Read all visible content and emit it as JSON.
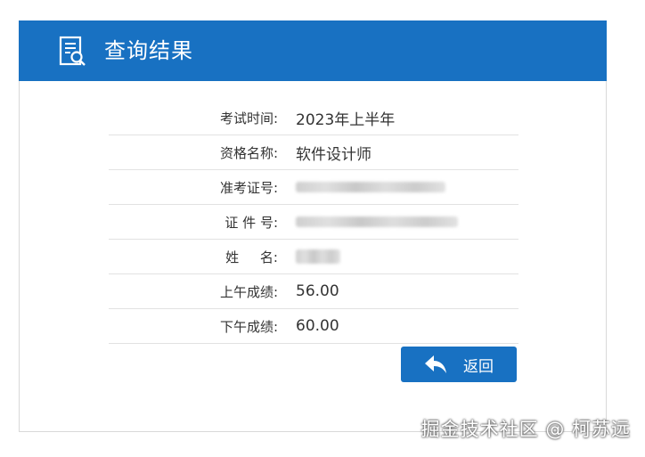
{
  "header": {
    "title": "查询结果",
    "icon": "document-search-icon"
  },
  "rows": [
    {
      "label": "考试时间:",
      "value": "2023年上半年"
    },
    {
      "label": "资格名称:",
      "value": "软件设计师"
    },
    {
      "label": "准考证号:",
      "value": ""
    },
    {
      "label": "证 件 号:",
      "value": ""
    },
    {
      "label": "姓     名:",
      "value": ""
    },
    {
      "label": "上午成绩:",
      "value": "56.00"
    },
    {
      "label": "下午成绩:",
      "value": "60.00"
    }
  ],
  "back_button": {
    "label": "返回",
    "icon": "back-arrow-icon"
  },
  "watermark": "掘金技术社区 @ 柯苏远",
  "colors": {
    "accent": "#1871c2"
  }
}
